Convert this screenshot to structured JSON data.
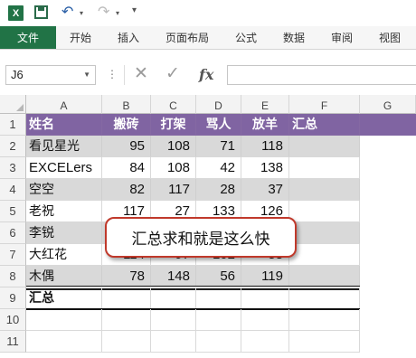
{
  "quick_access": {
    "app_icon": "X",
    "icons": [
      "excel-logo-icon",
      "save-icon",
      "undo-icon",
      "redo-icon",
      "customize-toolbar-icon"
    ]
  },
  "ribbon": {
    "file_label": "文件",
    "tabs": [
      "开始",
      "插入",
      "页面布局",
      "公式",
      "数据",
      "审阅",
      "视图"
    ]
  },
  "formula_bar": {
    "name_box": "J6",
    "fx_label": "fx",
    "formula": ""
  },
  "sheet": {
    "columns": [
      "A",
      "B",
      "C",
      "D",
      "E",
      "F",
      "G"
    ],
    "row_numbers": [
      "1",
      "2",
      "3",
      "4",
      "5",
      "6",
      "7",
      "8",
      "9",
      "10",
      "11"
    ],
    "header_row": [
      "姓名",
      "搬砖",
      "打架",
      "骂人",
      "放羊",
      "汇总"
    ],
    "rows": [
      [
        "看见星光",
        "95",
        "108",
        "71",
        "118",
        ""
      ],
      [
        "EXCELers",
        "84",
        "108",
        "42",
        "138",
        ""
      ],
      [
        "空空",
        "82",
        "117",
        "28",
        "37",
        ""
      ],
      [
        "老祝",
        "117",
        "27",
        "133",
        "126",
        ""
      ],
      [
        "李锐",
        "",
        "",
        "",
        "",
        ""
      ],
      [
        "大红花",
        "114",
        "97",
        "102",
        "58",
        ""
      ],
      [
        "木偶",
        "78",
        "148",
        "56",
        "119",
        ""
      ]
    ],
    "total_label": "汇总"
  },
  "callout": {
    "text": "汇总求和就是这么快"
  },
  "colors": {
    "excel_green": "#217346",
    "header_purple": "#8064a2",
    "band_gray": "#d9d9d9",
    "callout_border": "#c0392b"
  }
}
